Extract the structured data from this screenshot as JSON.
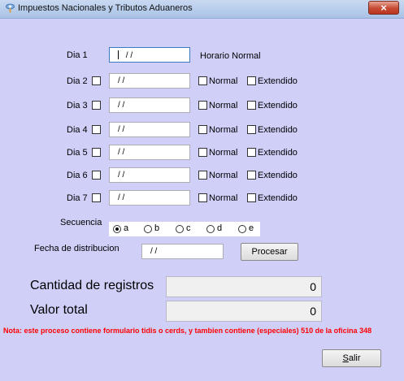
{
  "window": {
    "title": "Impuestos Nacionales y Tributos Aduaneros",
    "close_label": "×"
  },
  "days": [
    {
      "label": "Dia 1",
      "value": " / /",
      "has_checkbox": false,
      "horario": "Horario Normal"
    },
    {
      "label": "Dia 2",
      "value": " / /",
      "has_checkbox": true,
      "normal_label": "Normal",
      "extendido_label": "Extendido"
    },
    {
      "label": "Dia 3",
      "value": " / /",
      "has_checkbox": true,
      "normal_label": "Normal",
      "extendido_label": "Extendido"
    },
    {
      "label": "Dia 4",
      "value": " / /",
      "has_checkbox": true,
      "normal_label": "Normal",
      "extendido_label": "Extendido"
    },
    {
      "label": "Dia 5",
      "value": " / /",
      "has_checkbox": true,
      "normal_label": "Normal",
      "extendido_label": "Extendido"
    },
    {
      "label": "Dia 6",
      "value": " / /",
      "has_checkbox": true,
      "normal_label": "Normal",
      "extendido_label": "Extendido"
    },
    {
      "label": "Dia 7",
      "value": " / /",
      "has_checkbox": true,
      "normal_label": "Normal",
      "extendido_label": "Extendido"
    }
  ],
  "secuencia": {
    "label": "Secuencia",
    "options": [
      "a",
      "b",
      "c",
      "d",
      "e"
    ],
    "selected": "a"
  },
  "fecha": {
    "label": "Fecha de distribucion",
    "value": " / /"
  },
  "procesar_label": "Procesar",
  "cantidad": {
    "label": "Cantidad de registros",
    "value": "0"
  },
  "valor": {
    "label": "Valor total",
    "value": "0"
  },
  "note": "Nota: este proceso contiene formulario tidis o cerds, y tambien contiene (especiales) 510 de la oficina 348",
  "salir_label": "Salir"
}
